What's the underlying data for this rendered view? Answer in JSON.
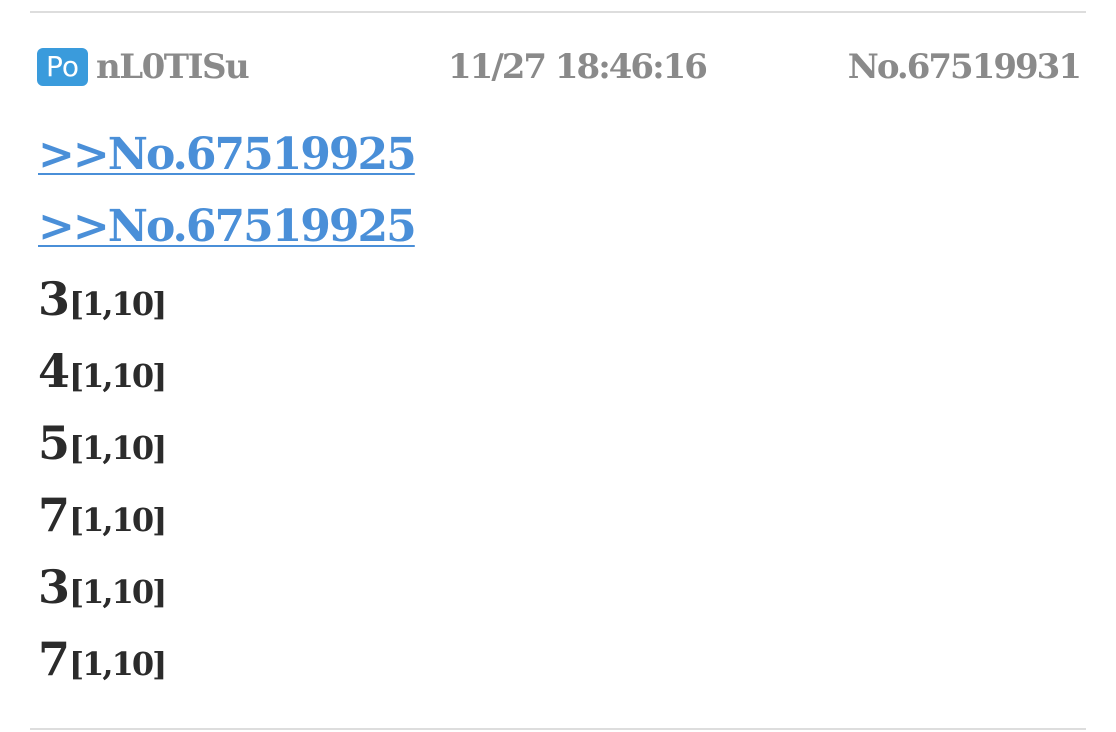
{
  "post": {
    "badge": "Po",
    "author_id": "nL0TISu",
    "timestamp": "11/27 18:46:16",
    "post_number": "No.67519931",
    "reply_links": [
      ">>No.67519925",
      ">>No.67519925"
    ],
    "dice_rolls": [
      {
        "value": "3",
        "range": "[1,10]"
      },
      {
        "value": "4",
        "range": "[1,10]"
      },
      {
        "value": "5",
        "range": "[1,10]"
      },
      {
        "value": "7",
        "range": "[1,10]"
      },
      {
        "value": "3",
        "range": "[1,10]"
      },
      {
        "value": "7",
        "range": "[1,10]"
      }
    ]
  },
  "colors": {
    "badge": "#3a9bdc",
    "link": "#4a8fd8",
    "meta_text": "#8a8a8a",
    "body_text": "#2b2b2b",
    "divider": "#dddddd"
  }
}
